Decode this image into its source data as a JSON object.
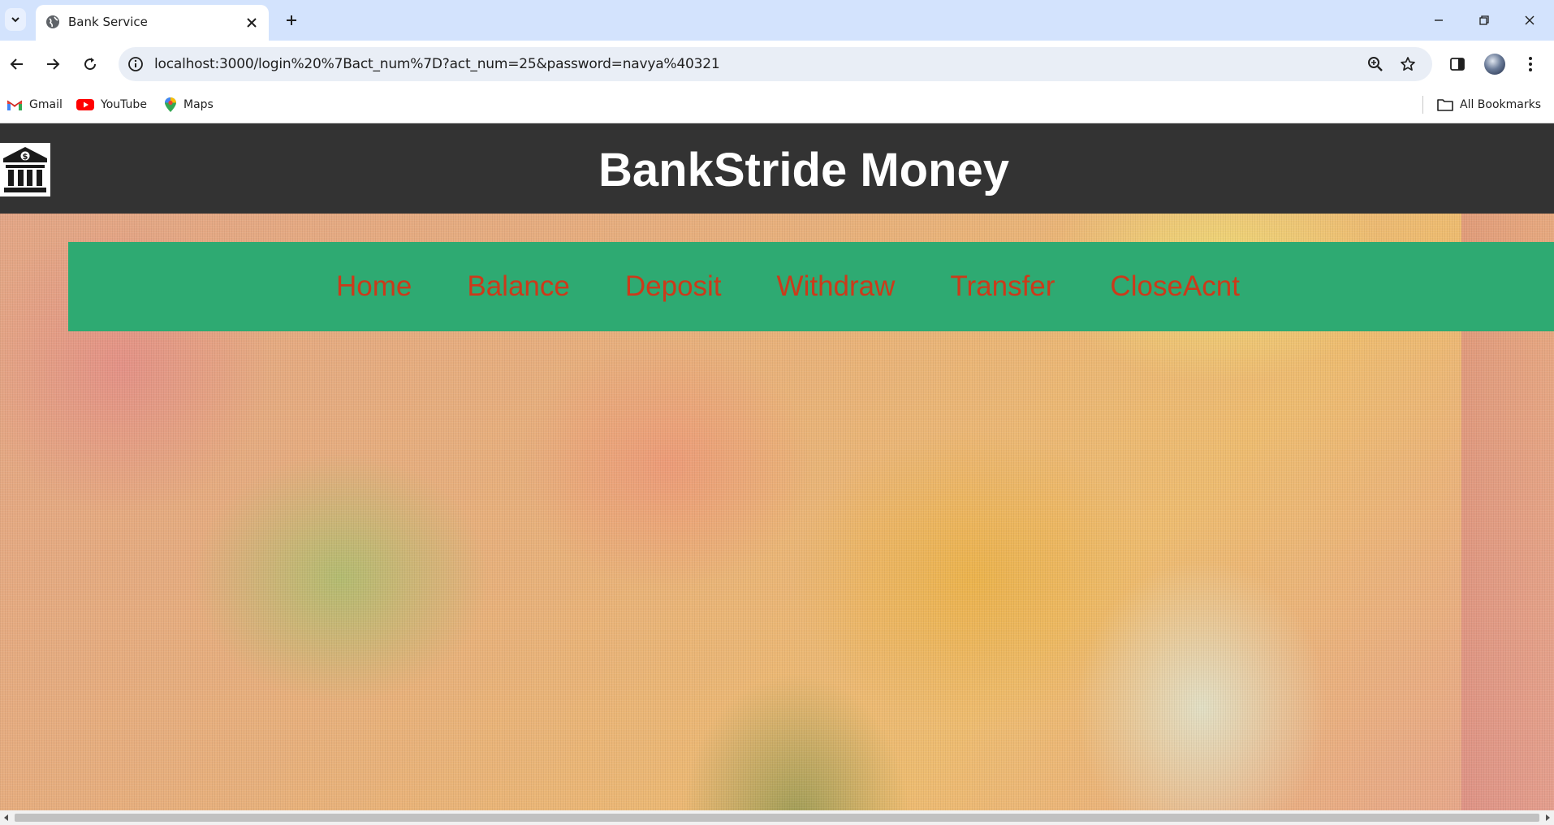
{
  "browser": {
    "tab": {
      "title": "Bank Service",
      "favicon": "globe-icon"
    },
    "url": "localhost:3000/login%20%7Bact_num%7D?act_num=25&password=navya%40321",
    "bookmarks": [
      {
        "label": "Gmail",
        "icon": "gmail-icon"
      },
      {
        "label": "YouTube",
        "icon": "youtube-icon"
      },
      {
        "label": "Maps",
        "icon": "maps-icon"
      }
    ],
    "all_bookmarks_label": "All Bookmarks"
  },
  "site": {
    "title": "BankStride Money",
    "logo_icon": "bank-icon",
    "nav": [
      "Home",
      "Balance",
      "Deposit",
      "Withdraw",
      "Transfer",
      "CloseAcnt"
    ]
  },
  "colors": {
    "header_bg": "#333333",
    "nav_bg": "#2eaa72",
    "nav_text": "#cc3a1a",
    "chrome_tabbar": "#d3e3fd"
  }
}
